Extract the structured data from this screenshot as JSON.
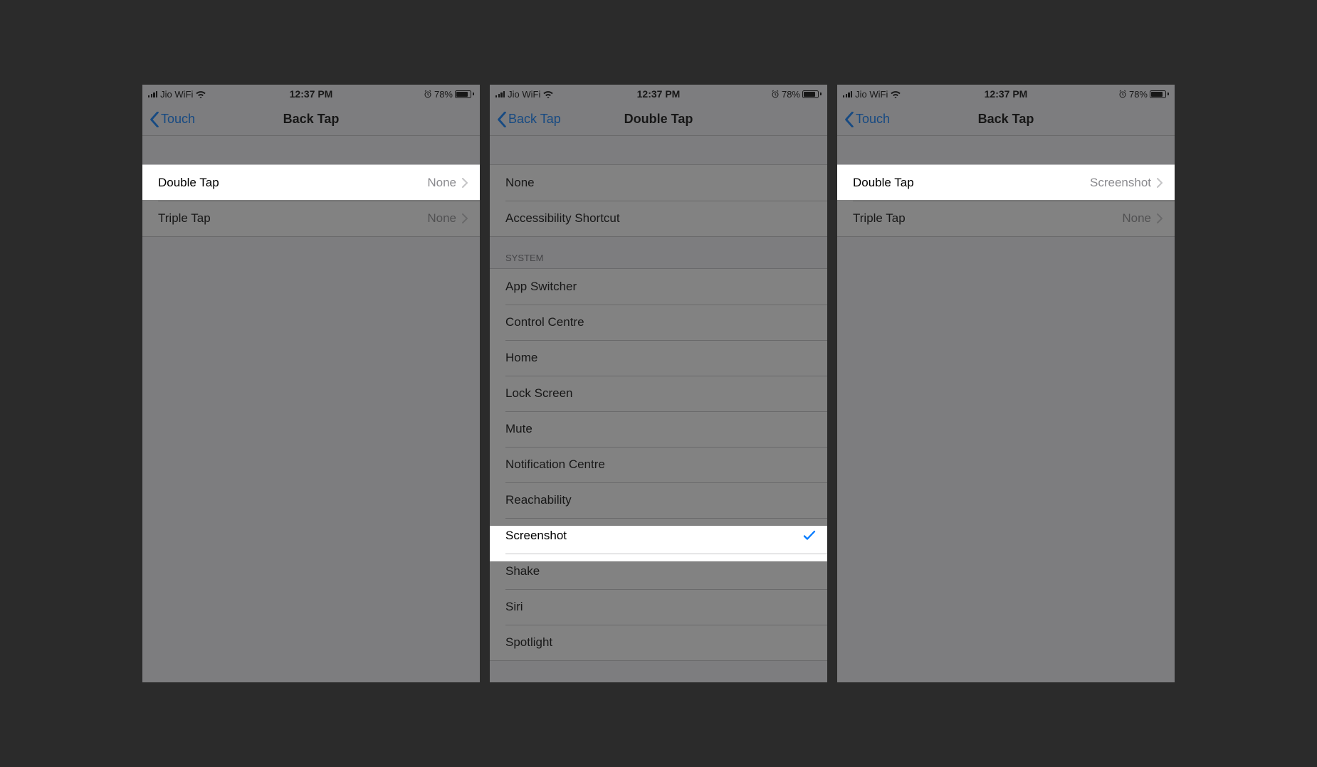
{
  "status_bar": {
    "carrier": "Jio WiFi",
    "time": "12:37 PM",
    "battery_percent": "78%"
  },
  "panel1": {
    "back_label": "Touch",
    "title": "Back Tap",
    "rows": [
      {
        "label": "Double Tap",
        "value": "None"
      },
      {
        "label": "Triple Tap",
        "value": "None"
      }
    ]
  },
  "panel2": {
    "back_label": "Back Tap",
    "title": "Double Tap",
    "top_rows": [
      {
        "label": "None"
      },
      {
        "label": "Accessibility Shortcut"
      }
    ],
    "system_header": "SYSTEM",
    "system_rows": [
      {
        "label": "App Switcher"
      },
      {
        "label": "Control Centre"
      },
      {
        "label": "Home"
      },
      {
        "label": "Lock Screen"
      },
      {
        "label": "Mute"
      },
      {
        "label": "Notification Centre"
      },
      {
        "label": "Reachability"
      },
      {
        "label": "Screenshot",
        "checked": true
      },
      {
        "label": "Shake"
      },
      {
        "label": "Siri"
      },
      {
        "label": "Spotlight"
      }
    ]
  },
  "panel3": {
    "back_label": "Touch",
    "title": "Back Tap",
    "rows": [
      {
        "label": "Double Tap",
        "value": "Screenshot"
      },
      {
        "label": "Triple Tap",
        "value": "None"
      }
    ]
  }
}
